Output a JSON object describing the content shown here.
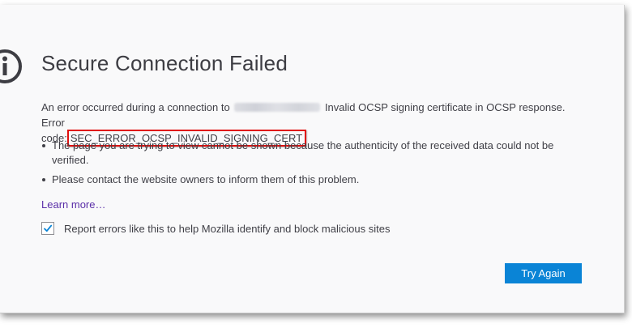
{
  "page": {
    "title": "Secure Connection Failed",
    "description_prefix": "An error occurred during a connection to",
    "description_suffix": "Invalid OCSP signing certificate in OCSP response. Error",
    "error_code_prefix": "code:",
    "error_code": "SEC_ERROR_OCSP_INVALID_SIGNING_CERT",
    "bullets": [
      "The page you are trying to view cannot be shown because the authenticity of the received data could not be verified.",
      "Please contact the website owners to inform them of this problem."
    ],
    "learn_more": "Learn more…",
    "report_checkbox_label": "Report errors like this to help Mozilla identify and block malicious sites",
    "report_checked": true,
    "try_again_label": "Try Again"
  },
  "colors": {
    "title": "#3d3d43",
    "link": "#5b2fa8",
    "button": "#0a84d6",
    "error_highlight": "#e0100f"
  },
  "icons": [
    "info-icon",
    "checkmark-icon"
  ]
}
